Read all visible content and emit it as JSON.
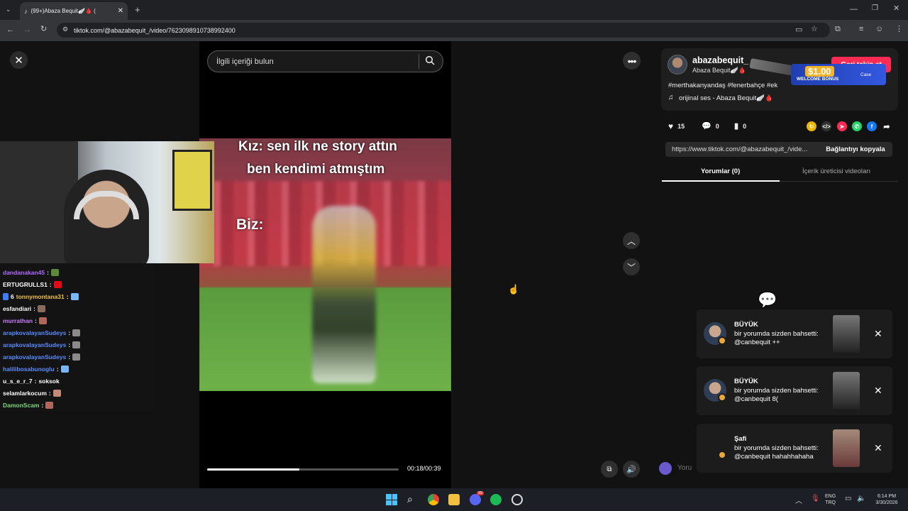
{
  "browser": {
    "tab_title": "(99+)Abaza Bequit🪽🩸 (",
    "url": "tiktok.com/@abazabequit_/video/7623098910738992400",
    "new_tab_glyph": "+"
  },
  "video": {
    "search_placeholder": "İlgili içeriği bulun",
    "caption_line1": "Kız: sen ilk ne story attın",
    "caption_line2": "ben kendimi atmıştım",
    "caption_biz": "Biz:",
    "progress": 0.48,
    "time": "00:18/00:39"
  },
  "chat": {
    "lines": [
      {
        "user": "dandanakan45",
        "msg": "",
        "color": "#b36bff"
      },
      {
        "user": "ERTUGRULLS1",
        "msg": "",
        "color": "#ffffff"
      },
      {
        "user": "tonnymontana31",
        "msg": "",
        "color": "#f0c040",
        "prefix": "6"
      },
      {
        "user": "esfandiari",
        "msg": "",
        "color": "#ffffff"
      },
      {
        "user": "murrathan",
        "msg": "",
        "color": "#c87dff"
      },
      {
        "user": "arapkovalayanSudeys",
        "msg": "",
        "color": "#5a8cff"
      },
      {
        "user": "arapkovalayanSudeys",
        "msg": "",
        "color": "#5a8cff"
      },
      {
        "user": "arapkovalayanSudeys",
        "msg": "",
        "color": "#5a8cff"
      },
      {
        "user": "halilibosabunoglu",
        "msg": "",
        "color": "#5a8cff"
      },
      {
        "user": "u_s_e_r_7",
        "msg": "soksok",
        "color": "#ffffff"
      },
      {
        "user": "selamlarkocum",
        "msg": "",
        "color": "#ffffff"
      },
      {
        "user": "DamonScam",
        "msg": "",
        "color": "#7dd87d"
      }
    ],
    "separator": ":"
  },
  "post": {
    "username": "abazabequit_",
    "display_name": "Abaza Bequit🪽🩸",
    "follow_label": "Geri takip et",
    "hashtags": "#merthakanyandaş #fenerbahçe #ek",
    "sound": "orijinal ses - Abaza Bequit🪽🩸",
    "likes": "15",
    "comments": "0",
    "saves": "0",
    "link": "https://www.tiktok.com/@abazabequit_/vide...",
    "copy_link_label": "Bağlantıyı kopyala",
    "tab_comments": "Yorumlar (0)",
    "tab_creator_videos": "İçerik üreticisi videoları",
    "comment_placeholder": "Yoru"
  },
  "promo": {
    "amount": "$1.00",
    "label": "WELCOME BONUS",
    "brand": "Case"
  },
  "notifications": [
    {
      "name": "BÜYÜK",
      "line1": "bir yorumda sizden bahsetti:",
      "line2": "@canbequit ++"
    },
    {
      "name": "BÜYÜK",
      "line1": "bir yorumda sizden bahsetti:",
      "line2": "@canbequit 8("
    },
    {
      "name": "Şafi",
      "line1": "bir yorumda sizden bahsetti:",
      "line2": "@canbequit hahahhahaha"
    }
  ],
  "taskbar": {
    "lang_top": "ENG",
    "lang_bottom": "TRQ",
    "time": "6:14 PM",
    "date": "3/30/2026",
    "discord_badge": "99"
  },
  "colors": {
    "accent": "#fe2c55",
    "panel": "#121212"
  }
}
